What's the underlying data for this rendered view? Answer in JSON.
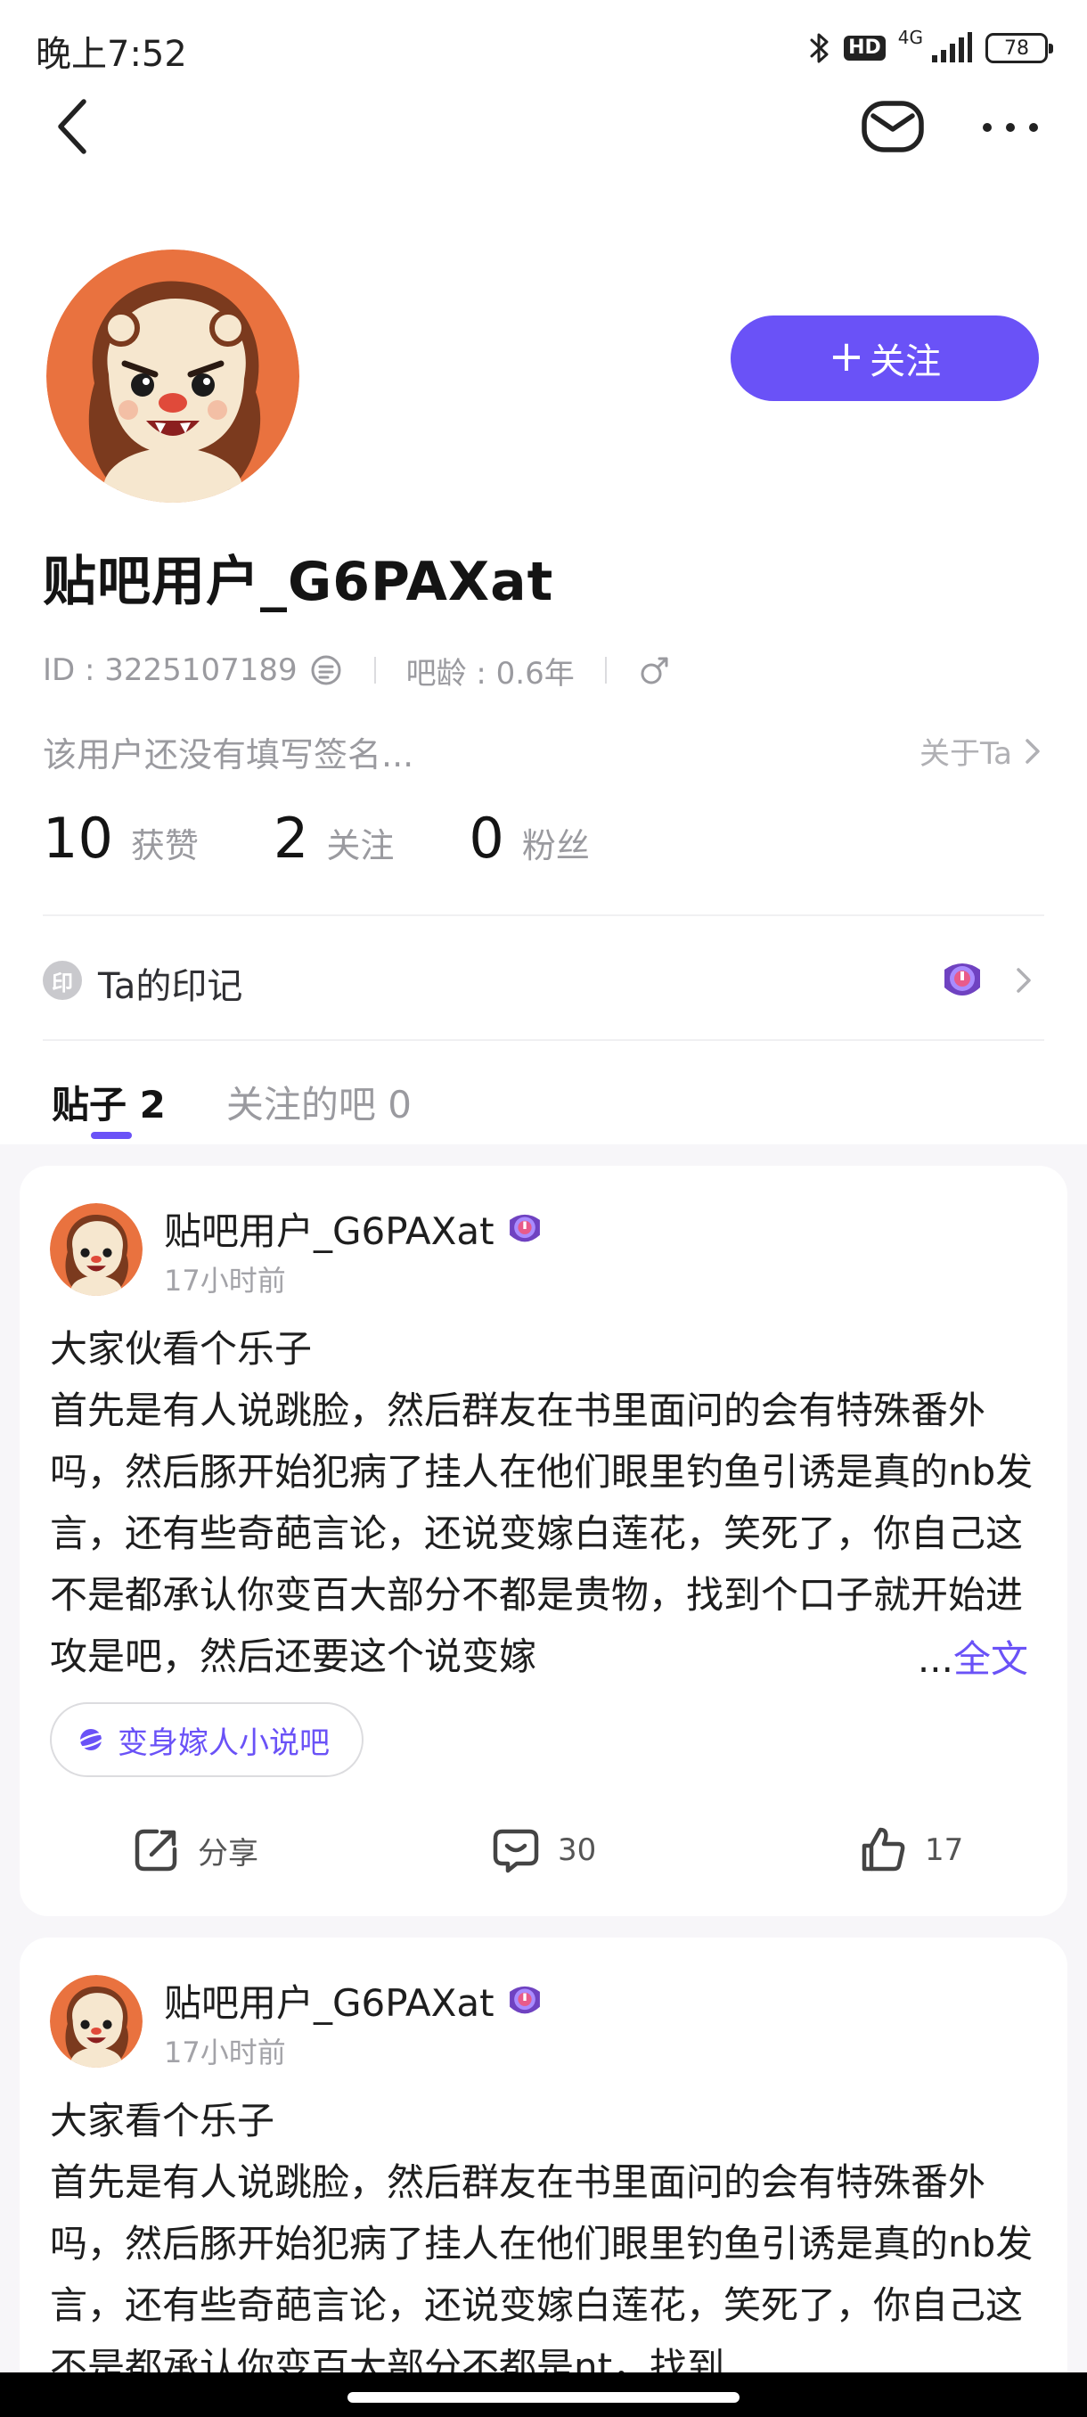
{
  "status_bar": {
    "time": "晚上7:52",
    "hd": "HD",
    "network": "4G",
    "battery": "78"
  },
  "profile": {
    "follow_label": "关注",
    "username": "贴吧用户_G6PAXat",
    "id_text": "ID : 3225107189",
    "bar_age": "吧龄 : 0.6年",
    "bio": "该用户还没有填写签名...",
    "about_label": "关于Ta",
    "stats": {
      "likes_count": "10",
      "likes_label": "获赞",
      "following_count": "2",
      "following_label": "关注",
      "fans_count": "0",
      "fans_label": "粉丝"
    },
    "mark_icon": "印",
    "mark_label": "Ta的印记"
  },
  "tabs": [
    {
      "label": "贴子 2"
    },
    {
      "label": "关注的吧 0"
    }
  ],
  "posts": [
    {
      "author": "贴吧用户_G6PAXat",
      "time": "17小时前",
      "title": "大家伙看个乐子",
      "body": "首先是有人说跳脸，然后群友在书里面问的会有特殊番外吗，然后豚开始犯病了挂人在他们眼里钓鱼引诱是真的nb发言，还有些奇葩言论，还说变嫁白莲花，笑死了，你自己这不是都承认你变百大部分不都是贵物，找到个口子就开始进攻是吧，然后还要这个说变嫁",
      "ellipsis": "...",
      "read_more": "全文",
      "forum": "变身嫁人小说吧",
      "share_label": "分享",
      "comment_count": "30",
      "like_count": "17"
    },
    {
      "author": "贴吧用户_G6PAXat",
      "time": "17小时前",
      "title": "大家看个乐子",
      "body": "首先是有人说跳脸，然后群友在书里面问的会有特殊番外吗，然后豚开始犯病了挂人在他们眼里钓鱼引诱是真的nb发言，还有些奇葩言论，还说变嫁白莲花，笑死了，你自己这不是都承认你变百大部分不都是nt，找到"
    }
  ],
  "icons": {
    "back": "chevron-left-icon",
    "message": "mail-icon",
    "more": "more-dots-icon",
    "copy": "copy-icon",
    "gender": "male-icon",
    "badge": "level-badge-icon",
    "forum": "planet-icon",
    "share": "share-icon",
    "comment": "comment-icon",
    "like": "thumbs-up-icon"
  },
  "colors": {
    "accent": "#6a52f7",
    "avatar_bg": "#e9723f"
  }
}
